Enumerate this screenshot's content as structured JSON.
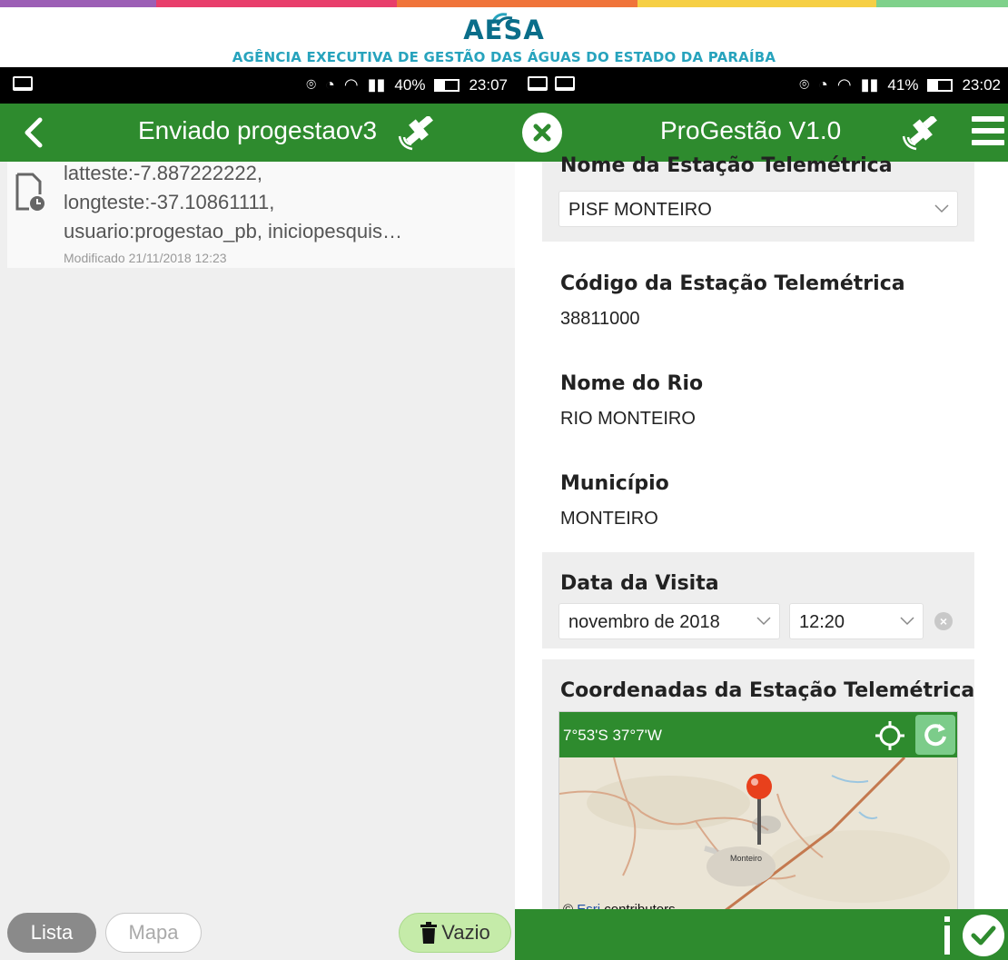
{
  "header": {
    "logo_text": "AESA",
    "subtitle": "AGÊNCIA EXECUTIVA DE GESTÃO DAS ÁGUAS DO ESTADO DA PARAÍBA",
    "rainbow_colors": [
      "#9c5fb5",
      "#e83e6b",
      "#f0743a",
      "#f6cf45",
      "#7fd18b"
    ]
  },
  "left_screen": {
    "statusbar": {
      "battery": "40%",
      "battery_level": 0.4,
      "time": "23:07"
    },
    "appbar": {
      "title": "Enviado progestaov3",
      "back_icon": "chevron-left-icon",
      "satellite_icon": "satellite-icon"
    },
    "list_items": [
      {
        "line1": "latteste:-7.887222222,",
        "line2": "longteste:-37.10861111,",
        "line3": "usuario:progestao_pb, iniciopesquis…",
        "meta": "Modificado 21/11/2018 12:23",
        "icon": "document-clock-icon"
      }
    ],
    "bottom": {
      "list_label": "Lista",
      "map_label": "Mapa",
      "empty_label": "Vazio"
    }
  },
  "right_screen": {
    "statusbar": {
      "battery": "41%",
      "battery_level": 0.41,
      "time": "23:02"
    },
    "appbar": {
      "title": "ProGestão V1.0",
      "close_icon": "close-circle-icon",
      "satellite_icon": "satellite-icon",
      "menu_icon": "hamburger-menu-icon"
    },
    "fields": {
      "station_name_label": "Nome da Estação Telemétrica",
      "station_name_value": "PISF MONTEIRO",
      "station_code_label": "Código da Estação Telemétrica",
      "station_code_value": "38811000",
      "river_label": "Nome do Rio",
      "river_value": "RIO MONTEIRO",
      "city_label": "Município",
      "city_value": "MONTEIRO",
      "visit_date_label": "Data da Visita",
      "visit_date_value": "novembro de 2018",
      "visit_time_value": "12:20",
      "coords_label": "Coordenadas da Estação Telemétrica"
    },
    "map": {
      "coords": "7°53'S 37°7'W",
      "attribution_prefix": "© ",
      "attribution_link": "Esri",
      "attribution_suffix": " contributors",
      "place_label": "Monteiro"
    }
  },
  "colors": {
    "green": "#2e8b2e",
    "refresh": "#7ccc8a",
    "pin": "#e8401c"
  }
}
